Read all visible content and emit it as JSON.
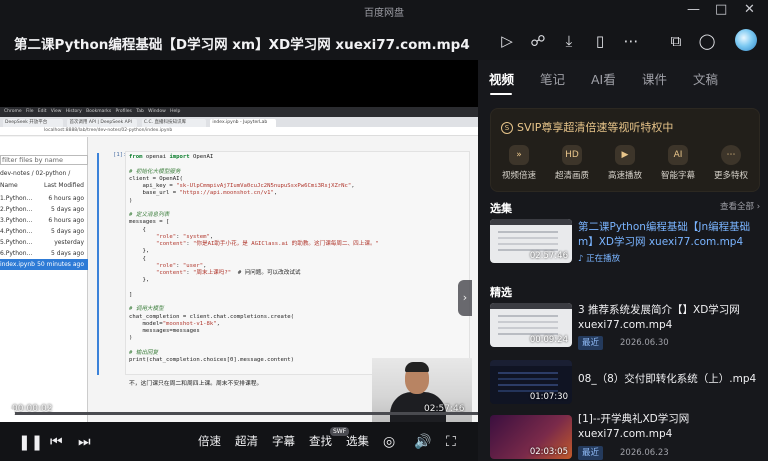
{
  "window": {
    "title": "百度网盘",
    "min_icon": "minimize-icon",
    "max_icon": "maximize-icon",
    "close_icon": "close-icon"
  },
  "player": {
    "video_title": "第二课Python编程基础【D学习网 xm】XD学习网 xuexi77.com.mp4",
    "toolbar_icons": [
      "add-to-playlist-icon",
      "share-icon",
      "download-icon",
      "phone-icon",
      "more-icon",
      "pip-icon",
      "pin-icon"
    ],
    "current_time": "00:00:02",
    "total_time": "02:57:46",
    "progress_fraction": 0.02
  },
  "screen_content": {
    "browser_menu": [
      "Chrome",
      "File",
      "Edit",
      "View",
      "History",
      "Bookmarks",
      "Profiles",
      "Tab",
      "Window",
      "Help"
    ],
    "browser_tabs": [
      "DeepSeek 开放平台",
      "首次调用 API | DeepSeek API",
      "C.C. 直播科技知识库",
      "index.ipynb - JupyterLab"
    ],
    "url": "localhost:8888/lab/tree/dev-notes/02-python/index.ipynb",
    "file_filter_placeholder": "filter files by name",
    "path": "dev-notes / 02-python /",
    "col_name": "Name",
    "col_modified": "Last Modified",
    "files": [
      {
        "name": "1.Python...",
        "modified": "6 hours ago"
      },
      {
        "name": "2.Python...",
        "modified": "5 days ago"
      },
      {
        "name": "3.Python...",
        "modified": "6 hours ago"
      },
      {
        "name": "4.Python...",
        "modified": "5 days ago"
      },
      {
        "name": "5.Python...",
        "modified": "yesterday"
      },
      {
        "name": "6.Python...",
        "modified": "5 days ago"
      },
      {
        "name": "index.ipynb",
        "modified": "50 minutes ago",
        "selected": true
      }
    ],
    "cell_prompt": "[1]:",
    "code_lines": [
      "from openai import OpenAI",
      "",
      "# 初始化大模型服务",
      "client = OpenAI(",
      "    api_key = \"sk-UlpCmmpivAj7IumVa0cuJc2N5nupuSsxPw6Cmi3RsjXZrNc\",",
      "    base_url = \"https://api.moonshot.cn/v1\",",
      ")",
      "",
      "# 定义消息列表",
      "messages = [",
      "    {",
      "        \"role\": \"system\",",
      "        \"content\": \"你是AI助手小花，是 AGIClass.ai 的助教。这门课每周二、四上课。\"",
      "    },",
      "    {",
      "        \"role\": \"user\",",
      "        \"content\": \"周末上课吗?\"  # 问问题。可以改改试试",
      "    },",
      "",
      "]",
      "",
      "# 调用大模型",
      "chat_completion = client.chat.completions.create(",
      "    model=\"moonshot-v1-8k\",",
      "    messages=messages",
      ")",
      "",
      "# 输出回复",
      "print(chat_completion.choices[0].message.content)"
    ],
    "output_text": "不，这门课只在周二和周四上课。周末不安排课程。"
  },
  "controls": {
    "speed": "倍速",
    "quality": "超清",
    "subtitle": "字幕",
    "search": "查找",
    "search_badge": "SWF",
    "episodes": "选集"
  },
  "panel": {
    "tabs": [
      "视频",
      "笔记",
      "AI看",
      "课件",
      "文稿"
    ],
    "active_tab": 0,
    "svip_title": "SVIP尊享超清倍速等视听特权中",
    "svip_badge": "S",
    "features": [
      {
        "label": "视频倍速",
        "icon": "speed-icon"
      },
      {
        "label": "超清画质",
        "icon": "hd-icon"
      },
      {
        "label": "高速播放",
        "icon": "fast-play-icon"
      },
      {
        "label": "智能字幕",
        "icon": "smart-subtitle-icon"
      },
      {
        "label": "更多特权",
        "icon": "more-icon"
      }
    ],
    "episodes_title": "选集",
    "view_all": "查看全部 ›",
    "current_episode": {
      "title": "第二课Python编程基础【Jn编程基础m】XD学习网 xuexi77.com.mp4",
      "duration": "02:57:46",
      "status": "正在播放"
    },
    "featured_title": "精选",
    "featured": [
      {
        "title": "3 推荐系统发展简介【】XD学习网 xuexi77.com.mp4",
        "duration": "00:09:24",
        "badge": "最近",
        "date": "2026.06.30"
      },
      {
        "title": "08_（8）交付即转化系统（上）.mp4",
        "duration": "01:07:30",
        "badge": "",
        "date": ""
      },
      {
        "title": "[1]--开学典礼XD学习网 xuexi77.com.mp4",
        "duration": "02:03:05",
        "badge": "最近",
        "date": "2026.06.23"
      }
    ]
  }
}
